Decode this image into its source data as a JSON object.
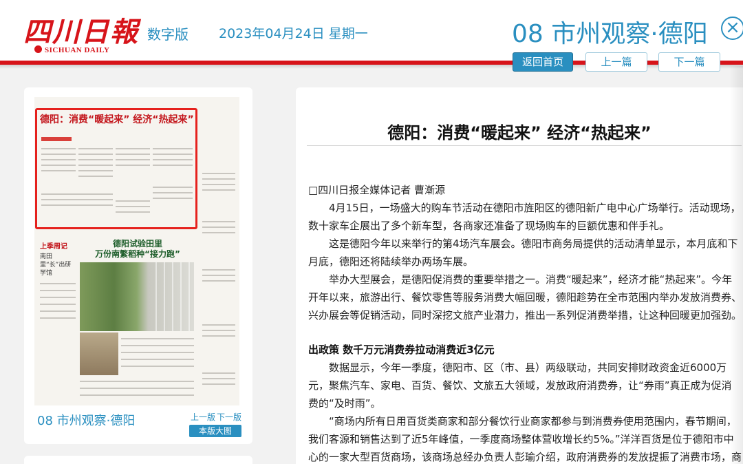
{
  "header": {
    "logo_cn": "四川日報",
    "logo_en": "SICHUAN DAILY",
    "edition": "数字版",
    "date": "2023年04月24日 星期一",
    "section_title": "08 市州观察·德阳",
    "close_icon": "close-icon",
    "nav": {
      "home": "返回首页",
      "prev": "上一篇",
      "next": "下一篇"
    }
  },
  "left_panel": {
    "thumbnail": {
      "headline": "德阳：消费“暖起来” 经济“热起来”",
      "photo_title_line1": "德阳试验田里",
      "photo_title_line2": "万份南繁稻种“接力跑”",
      "side_red": "上季周记",
      "side_text": "南田里“长”出研学馆"
    },
    "page_label": "08 市州观察·德阳",
    "prev_page": "上一版",
    "next_page": "下一版",
    "big_page_button": "本版大图"
  },
  "article": {
    "title": "德阳：消费“暖起来” 经济“热起来”",
    "byline": "□四川日报全媒体记者 曹漸源",
    "paragraphs": [
      "4月15日，一场盛大的购车节活动在德阳市旌阳区的德阳新广电中心广场举行。活动现场，数十家车企展出了多个新车型，各商家还准备了现场购车的巨额优惠和伴手礼。",
      "这是德阳今年以来举行的第4场汽车展会。德阳市商务局提供的活动清单显示，本月底和下月底，德阳还将陆续举办两场车展。",
      "举办大型展会，是德阳促消费的重要举措之一。消费“暖起来”，经济才能“热起来”。今年开年以来，旅游出行、餐饮零售等服务消费大幅回暖，德阳趁势在全市范围内举办发放消费券、兴办展会等促销活动，同时深挖文旅产业潜力，推出一系列促消费举措，让这种回暖更加强劲。"
    ],
    "subheading": "出政策 数千万元消费券拉动消费近3亿元",
    "paragraphs2": [
      "数据显示，今年一季度，德阳市、区（市、县）两级联动，共同安排财政资金近6000万元，聚焦汽车、家电、百货、餐饮、文旅五大领域，发放政府消费券，让“券雨”真正成为促消费的“及时雨”。",
      "“商场内所有日用百货类商家和部分餐饮行业商家都参与到消费券使用范围内，春节期间，我们客源和销售达到了近5年峰值，一季度商场整体营收增长约5%。”洋洋百货是位于德阳市中心的一家大型百货商场，该商场总经办负责人彭瑜介绍，政府消费券的发放提振了消费市场，商场也在经营战略方面做出了及时调整，比如增加入驻商家品牌品类、引入首店等。"
    ]
  },
  "colors": {
    "brand_red": "#d7141a",
    "accent_blue": "#2a8fc0"
  }
}
